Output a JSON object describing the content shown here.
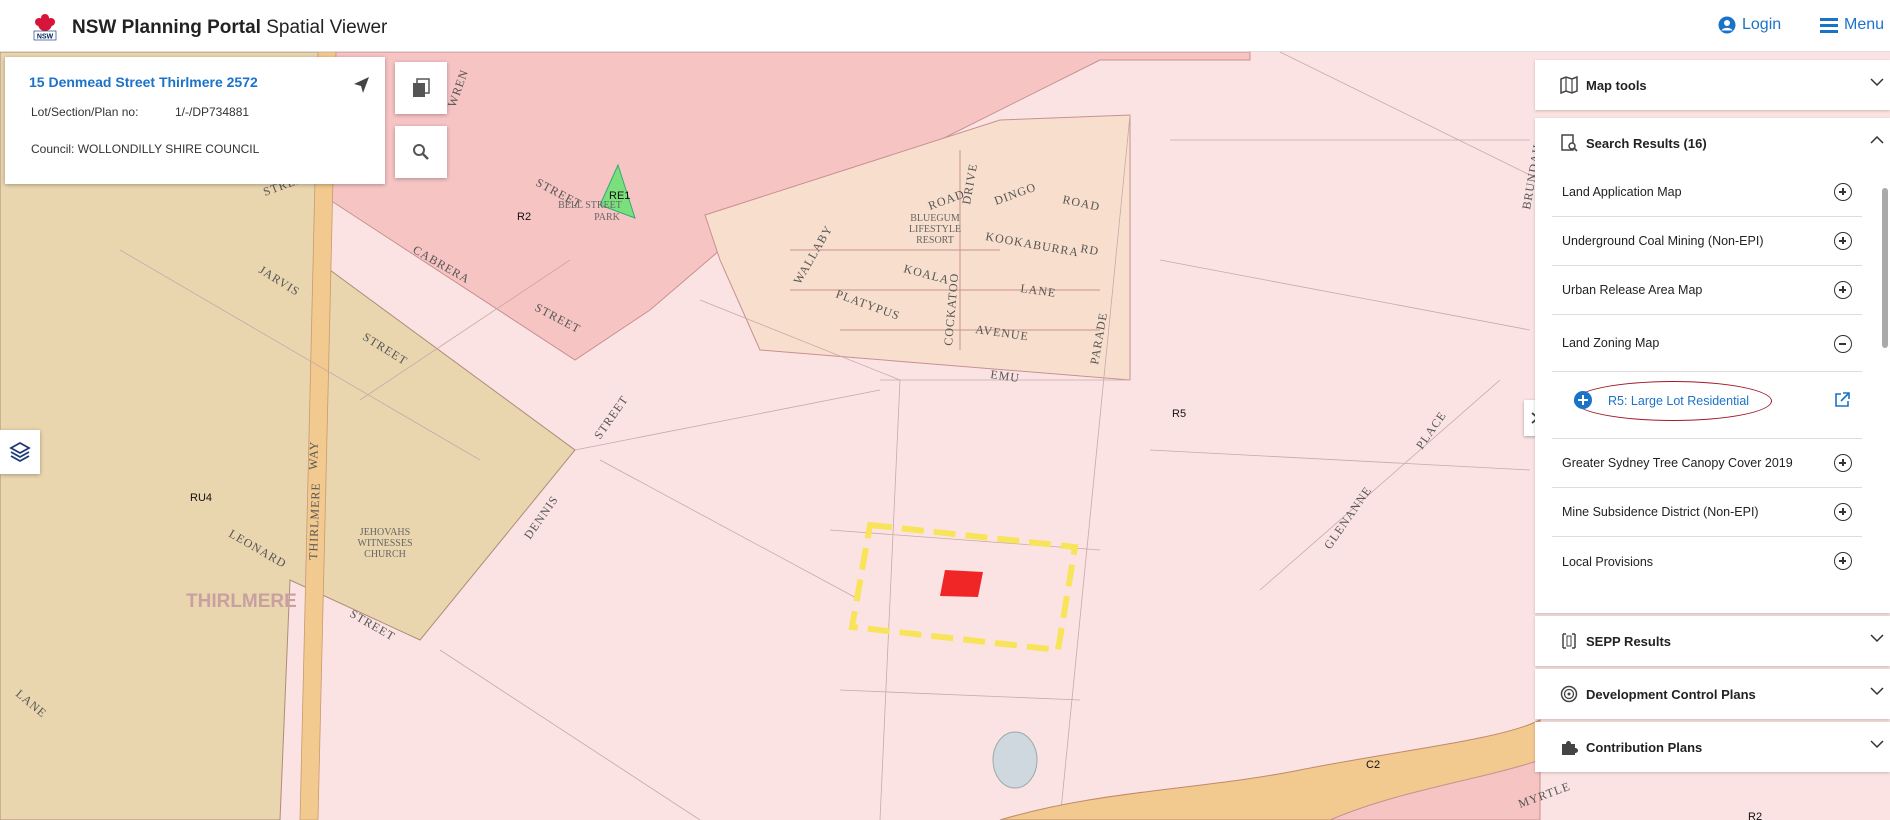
{
  "header": {
    "title_bold": "NSW Planning Portal",
    "title_rest": " Spatial Viewer",
    "login_label": "Login",
    "menu_label": "Menu",
    "logo_text": "NSW"
  },
  "info_card": {
    "address": "15 Denmead Street Thirlmere 2572",
    "lot_label": "Lot/Section/Plan no:",
    "lot_value": "1/-/DP734881",
    "council_text": "Council: WOLLONDILLY SHIRE COUNCIL"
  },
  "map": {
    "zone_labels": [
      "RE1",
      "R2",
      "R5",
      "RU4",
      "C2",
      "R2"
    ],
    "place_name": "THIRLMERE",
    "streets": [
      "STREET",
      "STREET",
      "CABRERA",
      "STREET",
      "JARVIS",
      "STREET",
      "WREN",
      "LEONARD",
      "THIRLMERE",
      "WAY",
      "STREET",
      "DENNIS",
      "STREET",
      "LANE",
      "WALLABY",
      "PLATYPUS",
      "KOALA",
      "COCKATOO",
      "DRIVE",
      "ROAD",
      "DINGO",
      "ROAD",
      "KOOKABURRA",
      "RD",
      "LANE",
      "AVENUE",
      "EMU",
      "PARADE",
      "GLENANNE",
      "PLACE",
      "BRUNDAH",
      "MYRTLE"
    ],
    "names": [
      "BELL STREET",
      "PARK",
      "BLUEGUM",
      "LIFESTYLE",
      "RESORT",
      "JEHOVAHS",
      "WITNESSES",
      "CHURCH"
    ],
    "colors": {
      "residential_low": "#fbe3e3",
      "residential_med": "#f7c4c4",
      "rural": "#e9d6ae",
      "recreation": "#7be07b",
      "environment": "#f2c98f",
      "selected_parcel": "#f7e45a"
    }
  },
  "panel": {
    "map_tools": "Map tools",
    "search_results": "Search Results (16)",
    "items": [
      {
        "label": "Land Application Map"
      },
      {
        "label": "Underground Coal Mining (Non-EPI)"
      },
      {
        "label": "Urban Release Area Map"
      },
      {
        "label": "Land Zoning Map"
      }
    ],
    "zone_item": "R5: Large Lot Residential",
    "items_after": [
      {
        "label": "Greater Sydney Tree Canopy Cover 2019"
      },
      {
        "label": "Mine Subsidence District (Non-EPI)"
      },
      {
        "label": "Local Provisions"
      }
    ],
    "sepp_results": "SEPP Results",
    "dev_control": "Development Control Plans",
    "contribution": "Contribution Plans"
  }
}
